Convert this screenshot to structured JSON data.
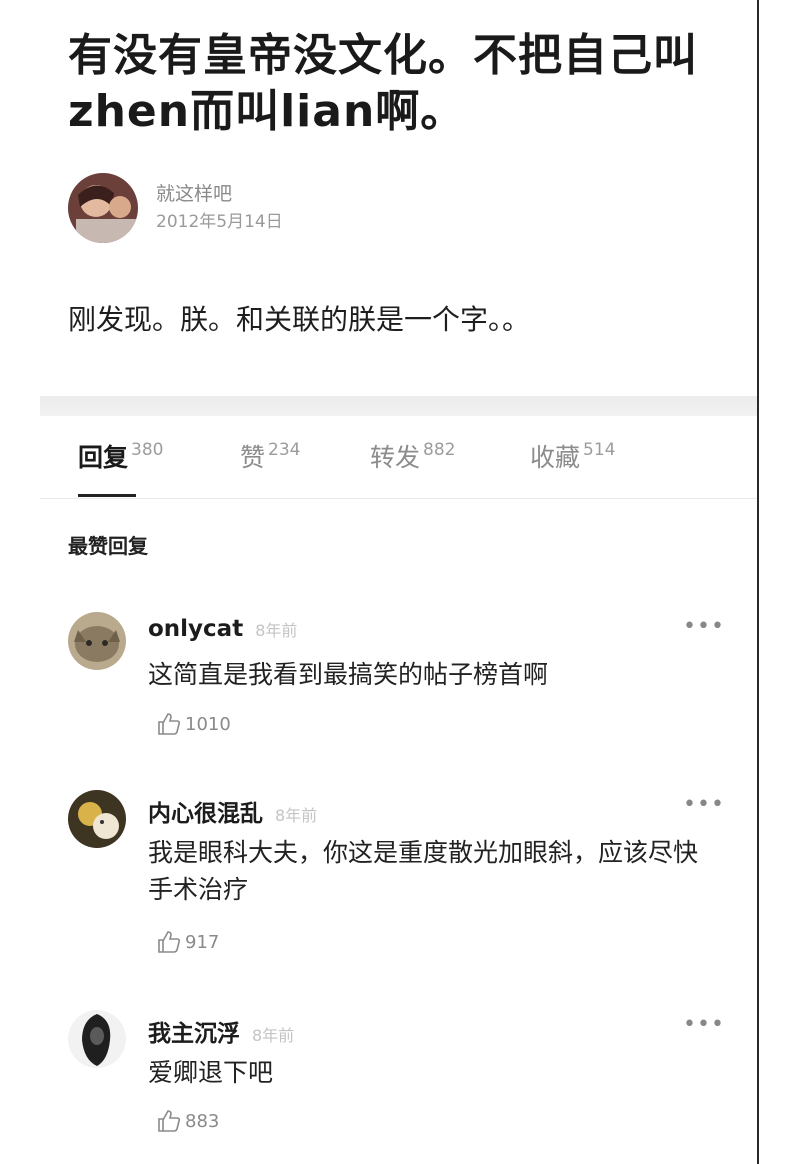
{
  "post": {
    "title": "有没有皇帝没文化。不把自己叫zhen而叫lian啊。",
    "author_name": "就这样吧",
    "date": "2012年5月14日",
    "body": "刚发现。朕。和关联的朕是一个字。。"
  },
  "tabs": [
    {
      "label": "回复",
      "count": "380",
      "active": true
    },
    {
      "label": "赞",
      "count": "234",
      "active": false
    },
    {
      "label": "转发",
      "count": "882",
      "active": false
    },
    {
      "label": "收藏",
      "count": "514",
      "active": false
    }
  ],
  "section_heading": "最赞回复",
  "replies": [
    {
      "name": "onlycat",
      "time": "8年前",
      "text": "这简直是我看到最搞笑的帖子榜首啊",
      "likes": "1010",
      "more": "•••"
    },
    {
      "name": "内心很混乱",
      "time": "8年前",
      "text": "我是眼科大夫，你这是重度散光加眼斜，应该尽快手术治疗",
      "likes": "917",
      "more": "•••"
    },
    {
      "name": "我主沉浮",
      "time": "8年前",
      "text": "爱卿退下吧",
      "likes": "883",
      "more": "•••"
    }
  ],
  "icons": {
    "author_avatar": "avatar-photo",
    "reply_avatar": "avatar-photo",
    "like": "thumbs-up-icon",
    "more": "more-dots-icon"
  },
  "colors": {
    "title": "#1a1a1a",
    "muted": "#8a8a8a",
    "time_faded": "#c4c4c4",
    "tab_underline": "#222222"
  }
}
